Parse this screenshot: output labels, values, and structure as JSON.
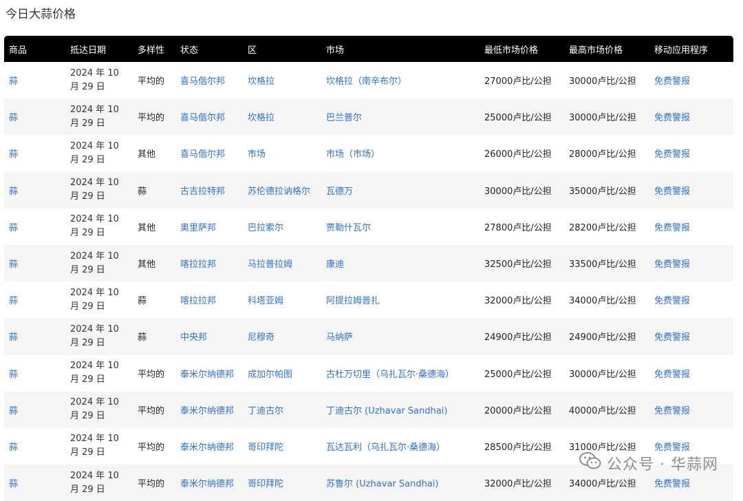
{
  "page": {
    "title": "今日大蒜价格"
  },
  "table": {
    "headers": [
      "商品",
      "抵达日期",
      "多样性",
      "状态",
      "区",
      "市场",
      "最低市场价格",
      "最高市场价格",
      "移动应用程序"
    ],
    "rows": [
      {
        "commodity": "蒜",
        "date": "2024 年 10 月 29 日",
        "variety": "平均的",
        "state": "喜马偕尔邦",
        "district": "坎格拉",
        "market": "坎格拉（南辛布尔）",
        "min": "27000卢比/公担",
        "max": "30000卢比/公担",
        "app": "免费警报"
      },
      {
        "commodity": "蒜",
        "date": "2024 年 10 月 29 日",
        "variety": "平均的",
        "state": "喜马偕尔邦",
        "district": "坎格拉",
        "market": "巴兰普尔",
        "min": "25000卢比/公担",
        "max": "30000卢比/公担",
        "app": "免费警报"
      },
      {
        "commodity": "蒜",
        "date": "2024 年 10 月 29 日",
        "variety": "其他",
        "state": "喜马偕尔邦",
        "district": "市场",
        "market": "市场（市场）",
        "min": "26000卢比/公担",
        "max": "28000卢比/公担",
        "app": "免费警报"
      },
      {
        "commodity": "蒜",
        "date": "2024 年 10 月 29 日",
        "variety": "蒜",
        "state": "古吉拉特邦",
        "district": "苏伦德拉讷格尔",
        "market": "瓦德万",
        "min": "30000卢比/公担",
        "max": "35000卢比/公担",
        "app": "免费警报"
      },
      {
        "commodity": "蒜",
        "date": "2024 年 10 月 29 日",
        "variety": "其他",
        "state": "奥里萨邦",
        "district": "巴拉索尔",
        "market": "贾勒什瓦尔",
        "min": "27800卢比/公担",
        "max": "28200卢比/公担",
        "app": "免费警报"
      },
      {
        "commodity": "蒜",
        "date": "2024 年 10 月 29 日",
        "variety": "其他",
        "state": "喀拉拉邦",
        "district": "马拉普拉姆",
        "market": "康迪",
        "min": "32500卢比/公担",
        "max": "33500卢比/公担",
        "app": "免费警报"
      },
      {
        "commodity": "蒜",
        "date": "2024 年 10 月 29 日",
        "variety": "蒜",
        "state": "喀拉拉邦",
        "district": "科塔亚姆",
        "market": "阿提拉姆普扎",
        "min": "32000卢比/公担",
        "max": "34000卢比/公担",
        "app": "免费警报"
      },
      {
        "commodity": "蒜",
        "date": "2024 年 10 月 29 日",
        "variety": "蒜",
        "state": "中央邦",
        "district": "尼穆奇",
        "market": "马纳萨",
        "min": "24900卢比/公担",
        "max": "24900卢比/公担",
        "app": "免费警报"
      },
      {
        "commodity": "蒜",
        "date": "2024 年 10 月 29 日",
        "variety": "平均的",
        "state": "泰米尔纳德邦",
        "district": "成加尔帕图",
        "market": "古杜万切里（乌扎瓦尔·桑德海）",
        "min": "25000卢比/公担",
        "max": "30000卢比/公担",
        "app": "免费警报"
      },
      {
        "commodity": "蒜",
        "date": "2024 年 10 月 29 日",
        "variety": "平均的",
        "state": "泰米尔纳德邦",
        "district": "丁迪古尔",
        "market": "丁迪古尔 (Uzhavar Sandhai)",
        "min": "20000卢比/公担",
        "max": "40000卢比/公担",
        "app": "免费警报"
      },
      {
        "commodity": "蒜",
        "date": "2024 年 10 月 29 日",
        "variety": "平均的",
        "state": "泰米尔纳德邦",
        "district": "哥印拜陀",
        "market": "瓦达瓦利（乌扎瓦尔·桑德海）",
        "min": "28500卢比/公担",
        "max": "31000卢比/公担",
        "app": "免费警报"
      },
      {
        "commodity": "蒜",
        "date": "2024 年 10 月 29 日",
        "variety": "平均的",
        "state": "泰米尔纳德邦",
        "district": "哥印拜陀",
        "market": "苏鲁尔 (Uzhavar Sandhai)",
        "min": "32000卢比/公担",
        "max": "34000卢比/公担",
        "app": "免费警报"
      }
    ]
  },
  "watermark": {
    "text": "公众号 · 华蒜网",
    "icon": "wechat-icon"
  },
  "colors": {
    "header_bg": "#000000",
    "link": "#2f6fd6",
    "stripe": "#f5f5f5"
  }
}
